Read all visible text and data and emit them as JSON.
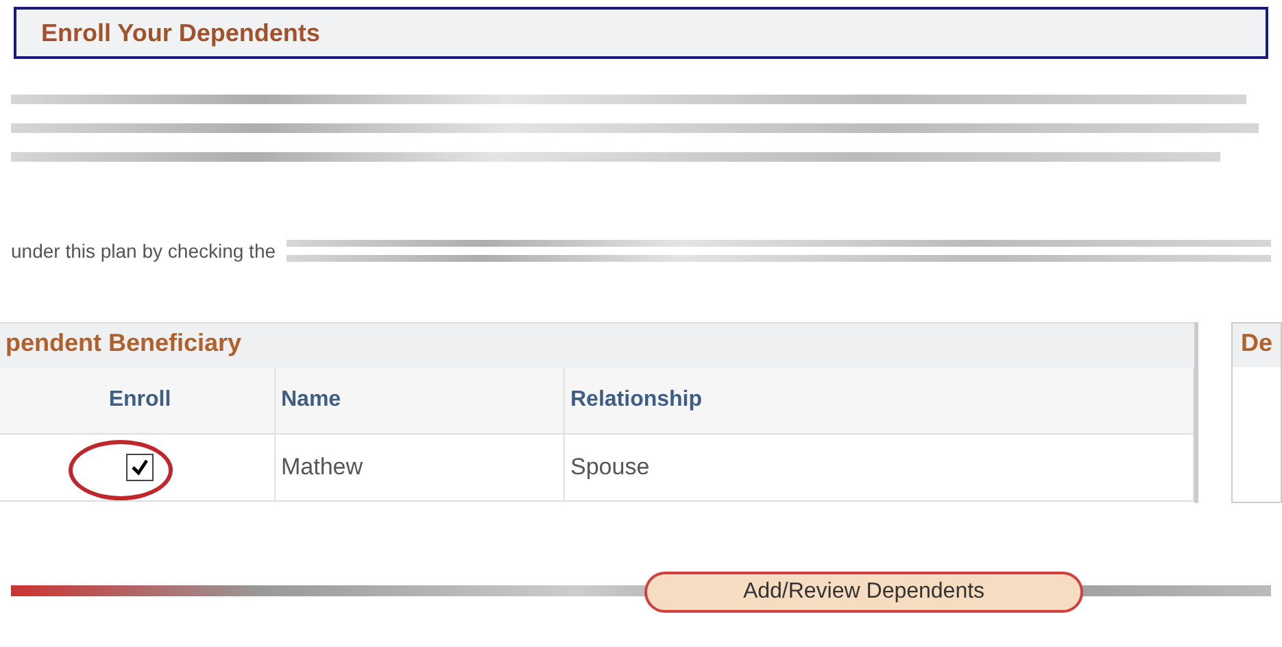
{
  "header": {
    "title": "Enroll Your Dependents"
  },
  "instructions": {
    "partial_line": "under this plan by checking the"
  },
  "table": {
    "title": "pendent Beneficiary",
    "columns": [
      "Enroll",
      "Name",
      "Relationship"
    ],
    "rows": [
      {
        "enroll_checked": true,
        "name": "Mathew",
        "relationship": "Spouse"
      }
    ]
  },
  "side_panel": {
    "title": "De"
  },
  "button": {
    "label": "Add/Review Dependents"
  }
}
